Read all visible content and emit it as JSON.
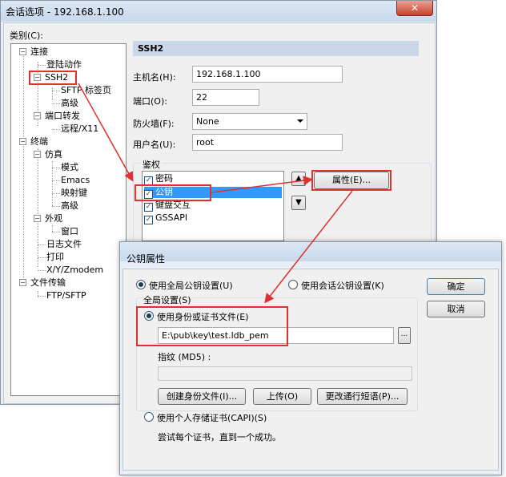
{
  "window": {
    "title": "会话选项 - 192.168.1.100",
    "close_glyph": "✕",
    "category_label": "类别(C):"
  },
  "tree": {
    "connection": "连接",
    "login_actions": "登陆动作",
    "ssh2": "SSH2",
    "sftp_tab": "SFTP 标签页",
    "advanced1": "高级",
    "port_forward": "端口转发",
    "remote_x11": "远程/X11",
    "terminal": "终端",
    "emulation": "仿真",
    "modes": "模式",
    "emacs": "Emacs",
    "mapped_keys": "映射键",
    "advanced2": "高级",
    "appearance": "外观",
    "window": "窗口",
    "log_file": "日志文件",
    "print": "打印",
    "xyzmodem": "X/Y/Zmodem",
    "file_transfer": "文件传输",
    "ftp_sftp": "FTP/SFTP",
    "expand_minus": "−"
  },
  "ssh2": {
    "header": "SSH2",
    "hostname_label": "主机名(H):",
    "hostname": "192.168.1.100",
    "port_label": "端口(O):",
    "port": "22",
    "firewall_label": "防火墙(F):",
    "firewall": "None",
    "username_label": "用户名(U):",
    "username": "root",
    "auth_label": "鉴权",
    "auth_methods": [
      {
        "label": "密码",
        "checked": true
      },
      {
        "label": "公钥",
        "checked": true,
        "selected": true
      },
      {
        "label": "键盘交互",
        "checked": true
      },
      {
        "label": "GSSAPI",
        "checked": true
      }
    ],
    "properties_button": "属性(E)...",
    "move_up": "▲",
    "move_down": "▼",
    "check_glyph": "✓"
  },
  "pubkey_dialog": {
    "title": "公钥属性",
    "use_global": "使用全局公钥设置(U)",
    "use_session": "使用会话公钥设置(K)",
    "ok": "确定",
    "cancel": "取消",
    "global_settings": "全局设置(S)",
    "use_identity_file": "使用身份或证书文件(E)",
    "identity_file_path": "E:\\pub\\key\\test.ldb_pem",
    "browse": "...",
    "fingerprint_label": "指纹 (MD5) :",
    "create_identity": "创建身份文件(I)...",
    "upload": "上传(O)",
    "change_passphrase": "更改通行短语(P)...",
    "use_capi": "使用个人存储证书(CAPI)(S)",
    "try_each_cert": "尝试每个证书，直到一个成功。"
  },
  "colors": {
    "annotation_red": "#e03030",
    "selection_blue": "#3399ff"
  }
}
